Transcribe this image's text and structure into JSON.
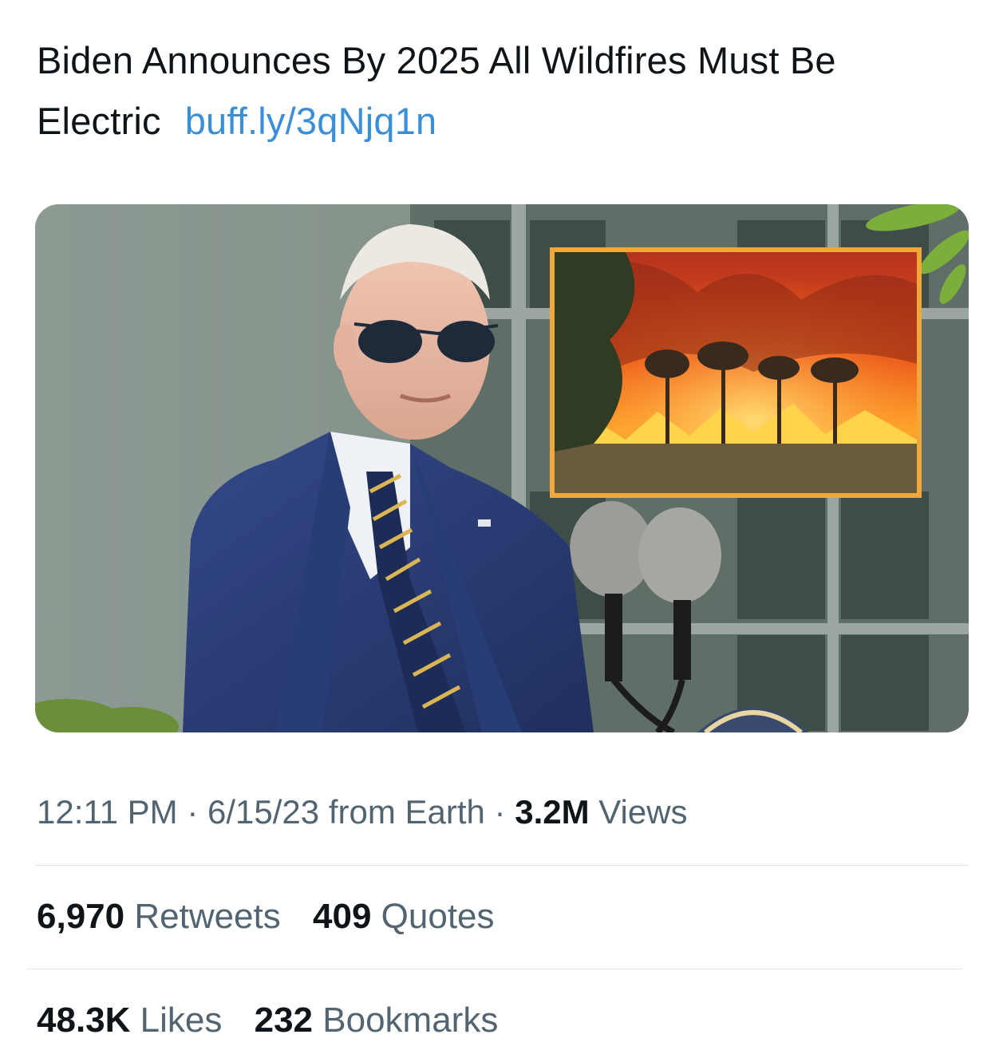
{
  "tweet": {
    "text": "Biden Announces By 2025 All Wildfires Must Be Electric",
    "link": "buff.ly/3qNjq1n"
  },
  "media": {
    "alt": "Photo of a man in sunglasses and a blue suit speaking at microphones, with an inset photo of a forest wildfire",
    "colors": {
      "frame": "#f0a83a",
      "suit": "#2b3f78",
      "fire": "#ff6a10"
    }
  },
  "meta": {
    "time": "12:11 PM",
    "sep1": "·",
    "date": "6/15/23",
    "source": "from Earth",
    "sep2": "·",
    "views_count": "3.2M",
    "views_label": "Views"
  },
  "stats": {
    "retweets_count": "6,970",
    "retweets_label": "Retweets",
    "quotes_count": "409",
    "quotes_label": "Quotes",
    "likes_count": "48.3K",
    "likes_label": "Likes",
    "bookmarks_count": "232",
    "bookmarks_label": "Bookmarks"
  },
  "colors": {
    "link": "#3a8fd9",
    "text": "#0f1419",
    "secondary": "#536471",
    "divider": "#e1e4e7"
  }
}
